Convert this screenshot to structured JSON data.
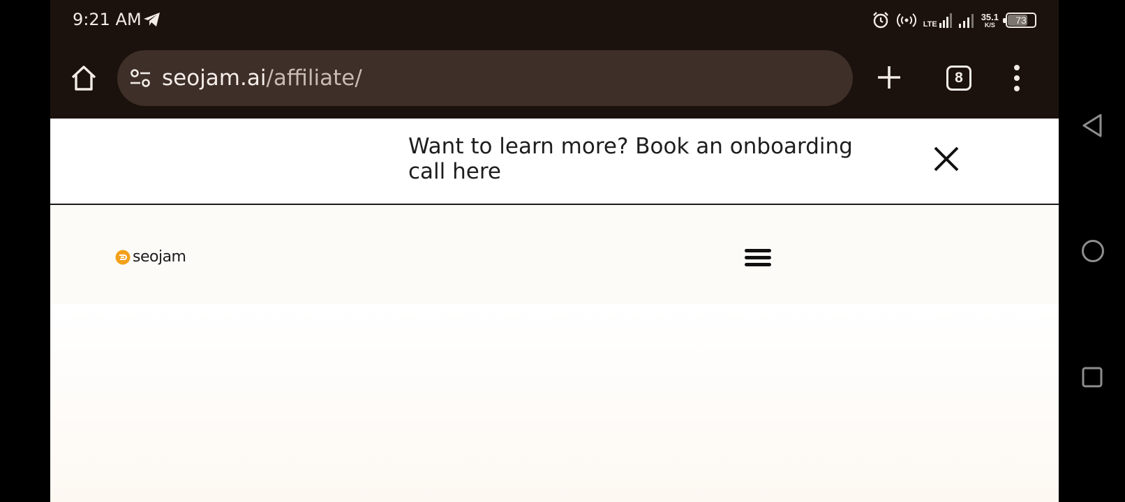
{
  "status_bar": {
    "time": "9:21 AM",
    "network_label": "LTE",
    "speed_value": "35.1",
    "speed_unit": "K/S",
    "battery": "73"
  },
  "browser": {
    "url_host": "seojam.ai",
    "url_path": "/affiliate/",
    "tab_count": "8"
  },
  "banner": {
    "text": "Want to learn more? Book an onboarding call here"
  },
  "site": {
    "logo_text": "seojam"
  },
  "colors": {
    "toolbar_bg": "#1c120d",
    "urlbar_bg": "#3e2f28",
    "brand_orange": "#f3a11b"
  }
}
